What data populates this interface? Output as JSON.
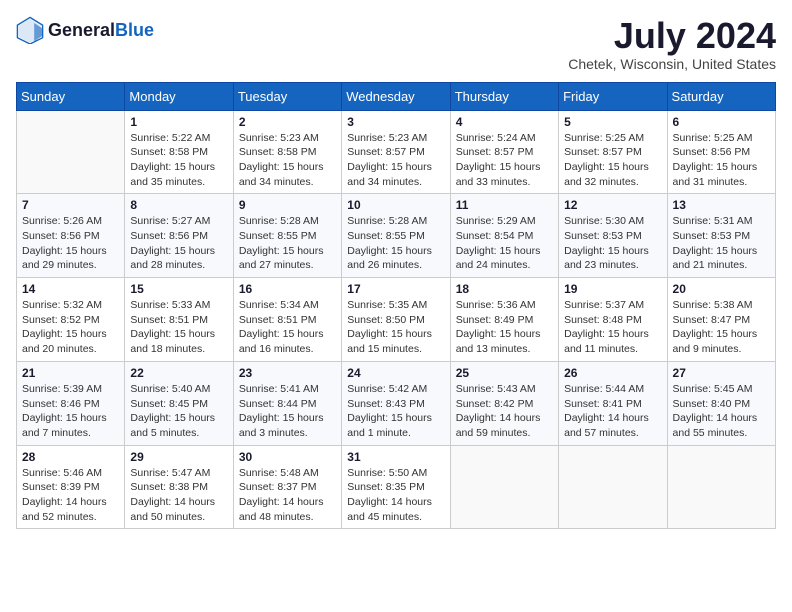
{
  "logo": {
    "text_general": "General",
    "text_blue": "Blue"
  },
  "title": {
    "month_year": "July 2024",
    "location": "Chetek, Wisconsin, United States"
  },
  "days_of_week": [
    "Sunday",
    "Monday",
    "Tuesday",
    "Wednesday",
    "Thursday",
    "Friday",
    "Saturday"
  ],
  "weeks": [
    [
      {
        "num": "",
        "info": ""
      },
      {
        "num": "1",
        "info": "Sunrise: 5:22 AM\nSunset: 8:58 PM\nDaylight: 15 hours\nand 35 minutes."
      },
      {
        "num": "2",
        "info": "Sunrise: 5:23 AM\nSunset: 8:58 PM\nDaylight: 15 hours\nand 34 minutes."
      },
      {
        "num": "3",
        "info": "Sunrise: 5:23 AM\nSunset: 8:57 PM\nDaylight: 15 hours\nand 34 minutes."
      },
      {
        "num": "4",
        "info": "Sunrise: 5:24 AM\nSunset: 8:57 PM\nDaylight: 15 hours\nand 33 minutes."
      },
      {
        "num": "5",
        "info": "Sunrise: 5:25 AM\nSunset: 8:57 PM\nDaylight: 15 hours\nand 32 minutes."
      },
      {
        "num": "6",
        "info": "Sunrise: 5:25 AM\nSunset: 8:56 PM\nDaylight: 15 hours\nand 31 minutes."
      }
    ],
    [
      {
        "num": "7",
        "info": "Sunrise: 5:26 AM\nSunset: 8:56 PM\nDaylight: 15 hours\nand 29 minutes."
      },
      {
        "num": "8",
        "info": "Sunrise: 5:27 AM\nSunset: 8:56 PM\nDaylight: 15 hours\nand 28 minutes."
      },
      {
        "num": "9",
        "info": "Sunrise: 5:28 AM\nSunset: 8:55 PM\nDaylight: 15 hours\nand 27 minutes."
      },
      {
        "num": "10",
        "info": "Sunrise: 5:28 AM\nSunset: 8:55 PM\nDaylight: 15 hours\nand 26 minutes."
      },
      {
        "num": "11",
        "info": "Sunrise: 5:29 AM\nSunset: 8:54 PM\nDaylight: 15 hours\nand 24 minutes."
      },
      {
        "num": "12",
        "info": "Sunrise: 5:30 AM\nSunset: 8:53 PM\nDaylight: 15 hours\nand 23 minutes."
      },
      {
        "num": "13",
        "info": "Sunrise: 5:31 AM\nSunset: 8:53 PM\nDaylight: 15 hours\nand 21 minutes."
      }
    ],
    [
      {
        "num": "14",
        "info": "Sunrise: 5:32 AM\nSunset: 8:52 PM\nDaylight: 15 hours\nand 20 minutes."
      },
      {
        "num": "15",
        "info": "Sunrise: 5:33 AM\nSunset: 8:51 PM\nDaylight: 15 hours\nand 18 minutes."
      },
      {
        "num": "16",
        "info": "Sunrise: 5:34 AM\nSunset: 8:51 PM\nDaylight: 15 hours\nand 16 minutes."
      },
      {
        "num": "17",
        "info": "Sunrise: 5:35 AM\nSunset: 8:50 PM\nDaylight: 15 hours\nand 15 minutes."
      },
      {
        "num": "18",
        "info": "Sunrise: 5:36 AM\nSunset: 8:49 PM\nDaylight: 15 hours\nand 13 minutes."
      },
      {
        "num": "19",
        "info": "Sunrise: 5:37 AM\nSunset: 8:48 PM\nDaylight: 15 hours\nand 11 minutes."
      },
      {
        "num": "20",
        "info": "Sunrise: 5:38 AM\nSunset: 8:47 PM\nDaylight: 15 hours\nand 9 minutes."
      }
    ],
    [
      {
        "num": "21",
        "info": "Sunrise: 5:39 AM\nSunset: 8:46 PM\nDaylight: 15 hours\nand 7 minutes."
      },
      {
        "num": "22",
        "info": "Sunrise: 5:40 AM\nSunset: 8:45 PM\nDaylight: 15 hours\nand 5 minutes."
      },
      {
        "num": "23",
        "info": "Sunrise: 5:41 AM\nSunset: 8:44 PM\nDaylight: 15 hours\nand 3 minutes."
      },
      {
        "num": "24",
        "info": "Sunrise: 5:42 AM\nSunset: 8:43 PM\nDaylight: 15 hours\nand 1 minute."
      },
      {
        "num": "25",
        "info": "Sunrise: 5:43 AM\nSunset: 8:42 PM\nDaylight: 14 hours\nand 59 minutes."
      },
      {
        "num": "26",
        "info": "Sunrise: 5:44 AM\nSunset: 8:41 PM\nDaylight: 14 hours\nand 57 minutes."
      },
      {
        "num": "27",
        "info": "Sunrise: 5:45 AM\nSunset: 8:40 PM\nDaylight: 14 hours\nand 55 minutes."
      }
    ],
    [
      {
        "num": "28",
        "info": "Sunrise: 5:46 AM\nSunset: 8:39 PM\nDaylight: 14 hours\nand 52 minutes."
      },
      {
        "num": "29",
        "info": "Sunrise: 5:47 AM\nSunset: 8:38 PM\nDaylight: 14 hours\nand 50 minutes."
      },
      {
        "num": "30",
        "info": "Sunrise: 5:48 AM\nSunset: 8:37 PM\nDaylight: 14 hours\nand 48 minutes."
      },
      {
        "num": "31",
        "info": "Sunrise: 5:50 AM\nSunset: 8:35 PM\nDaylight: 14 hours\nand 45 minutes."
      },
      {
        "num": "",
        "info": ""
      },
      {
        "num": "",
        "info": ""
      },
      {
        "num": "",
        "info": ""
      }
    ]
  ]
}
